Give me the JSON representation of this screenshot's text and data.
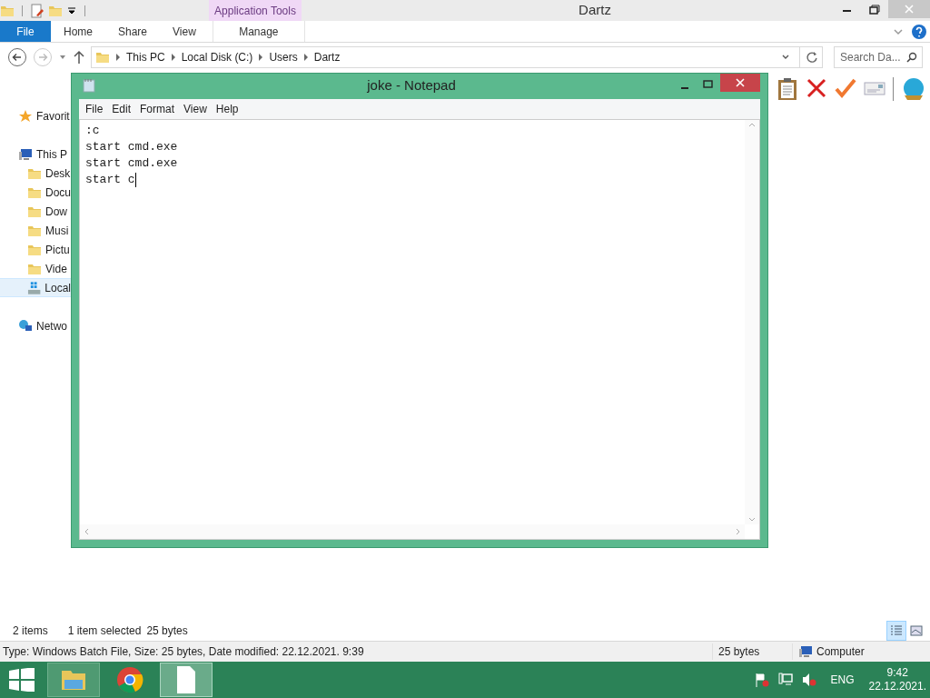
{
  "explorer": {
    "title": "Dartz",
    "context_tab": "Application Tools",
    "ribbon_tabs": [
      {
        "label": "File",
        "kind": "file"
      },
      {
        "label": "Home",
        "kind": "plain"
      },
      {
        "label": "Share",
        "kind": "plain"
      },
      {
        "label": "View",
        "kind": "plain"
      },
      {
        "label": "Manage",
        "kind": "context"
      }
    ],
    "breadcrumb": [
      "This PC",
      "Local Disk (C:)",
      "Users",
      "Dartz"
    ],
    "search": {
      "placeholder": "Search Da..."
    },
    "sidebar": [
      {
        "label": "Favorit",
        "kind": "star",
        "selected": false
      },
      {
        "label": "This P",
        "kind": "pc",
        "selected": false,
        "children": [
          {
            "label": "Desk",
            "kind": "folder",
            "selected": false
          },
          {
            "label": "Docu",
            "kind": "folder",
            "selected": false
          },
          {
            "label": "Dow",
            "kind": "folder",
            "selected": false
          },
          {
            "label": "Musi",
            "kind": "folder",
            "selected": false
          },
          {
            "label": "Pictu",
            "kind": "folder",
            "selected": false
          },
          {
            "label": "Vide",
            "kind": "folder",
            "selected": false
          },
          {
            "label": "Local",
            "kind": "disk",
            "selected": true
          }
        ]
      },
      {
        "label": "Netwo",
        "kind": "network",
        "selected": false
      }
    ],
    "status": {
      "count": "2 items",
      "selection": "1 item selected",
      "size": "25 bytes"
    },
    "view_buttons": [
      {
        "kind": "details",
        "selected": true
      },
      {
        "kind": "large",
        "selected": false
      }
    ],
    "details_bar": {
      "info": "Type: Windows Batch File, Size: 25 bytes, Date modified: 22.12.2021. 9:39",
      "size": "25 bytes",
      "location": "Computer"
    }
  },
  "notepad": {
    "title": "joke - Notepad",
    "menu": [
      "File",
      "Edit",
      "Format",
      "View",
      "Help"
    ],
    "lines": [
      ":c",
      "start cmd.exe",
      "start cmd.exe",
      "start c"
    ]
  },
  "taskbar": {
    "apps": [
      {
        "kind": "explorer",
        "selected": false
      },
      {
        "kind": "chrome",
        "selected": false
      },
      {
        "kind": "notepad",
        "selected": true
      }
    ],
    "language": "ENG",
    "time": "9:42",
    "date": "22.12.2021."
  }
}
